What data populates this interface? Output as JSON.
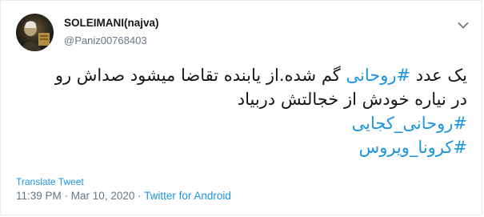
{
  "user": {
    "display_name": "SOLEIMANI(najva)",
    "handle": "@Paniz00768403"
  },
  "tweet": {
    "lines": [
      {
        "hashtag": "#روحانی",
        "before": "یک عدد ",
        "after": " گم شده.از یابنده تقاضا میشود صداش رو"
      },
      {
        "text": "در نیاره خودش از خجالتش دربیاد"
      },
      {
        "hashtag": "#روحانی_کجایی"
      },
      {
        "hashtag": "#کرونا_ویروس"
      }
    ]
  },
  "translate_label": "Translate Tweet",
  "meta": {
    "time": "11:39 PM",
    "separator": " · ",
    "date": "Mar 10, 2020",
    "source": "Twitter for Android"
  },
  "colors": {
    "link": "#1b95e0",
    "secondary_text": "#657786",
    "border": "#e6ecf0"
  },
  "icons": {
    "more": "chevron-down-icon"
  }
}
